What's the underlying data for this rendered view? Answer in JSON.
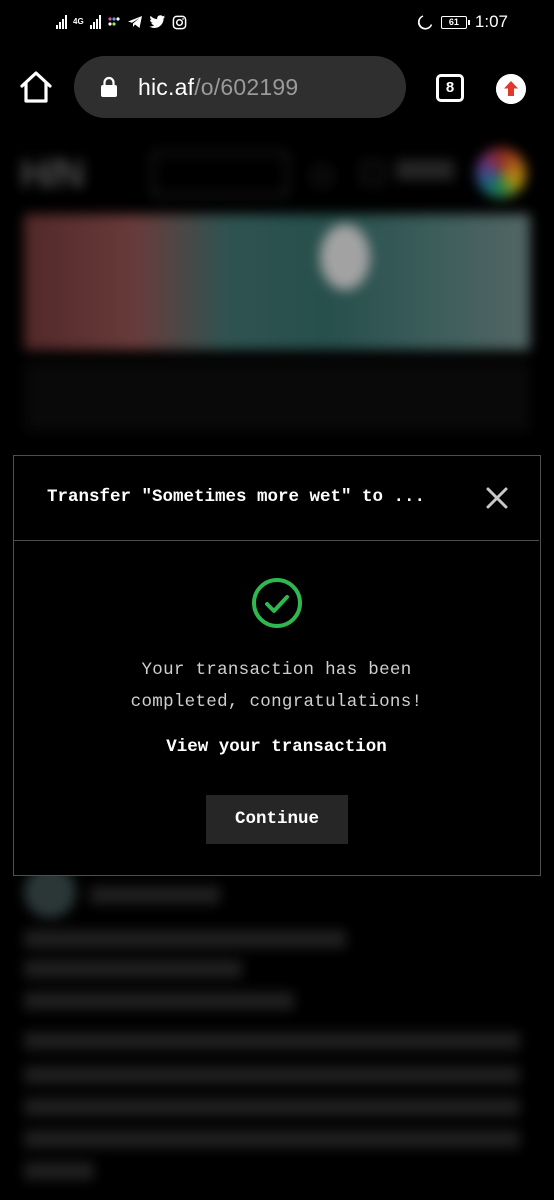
{
  "status_bar": {
    "network_tag": "4G",
    "battery_level": "61",
    "time": "1:07",
    "icons": [
      "signal-icon",
      "signal-icon",
      "app-notification-icon",
      "telegram-icon",
      "twitter-icon",
      "instagram-icon",
      "moon-icon",
      "battery-icon"
    ]
  },
  "browser": {
    "url_host": "hic.af",
    "url_path": "/o/602199",
    "tab_count": "8"
  },
  "modal": {
    "title": "Transfer \"Sometimes more wet\" to ...",
    "message_line1": "Your transaction has been",
    "message_line2": "completed, congratulations!",
    "view_link": "View your transaction",
    "continue_label": "Continue",
    "success_color": "#2eb84f"
  }
}
